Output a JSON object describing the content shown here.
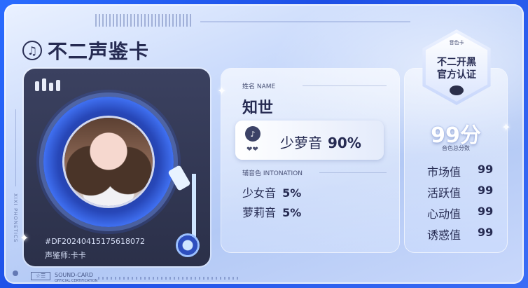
{
  "header": {
    "title": "不二声鉴卡",
    "music_icon": "music-note-icon"
  },
  "player": {
    "serial": "#DF20240415175618072",
    "author": "声鉴师:卡卡"
  },
  "profile": {
    "name_label": "姓名 NAME",
    "name": "知世",
    "main_voice": {
      "label": "少萝音",
      "percent": "90%"
    },
    "aux_label": "辅音色 INTONATION",
    "aux": [
      {
        "label": "少女音",
        "percent": "5%"
      },
      {
        "label": "萝莉音",
        "percent": "5%"
      }
    ]
  },
  "badge": {
    "tag": "音色卡",
    "line1": "不二开黑",
    "line2": "官方认证"
  },
  "score": {
    "value": "99分",
    "label": "音色总分数"
  },
  "stats": [
    {
      "label": "市场值",
      "value": "99"
    },
    {
      "label": "活跃值",
      "value": "99"
    },
    {
      "label": "心动值",
      "value": "99"
    },
    {
      "label": "诱惑值",
      "value": "99"
    }
  ],
  "footer": {
    "box": "☆☰",
    "title": "SOUND-CARD",
    "subtitle": "OFFICIAL CERTIFICATION"
  },
  "side": {
    "text": "XIXI PHONETICS"
  }
}
